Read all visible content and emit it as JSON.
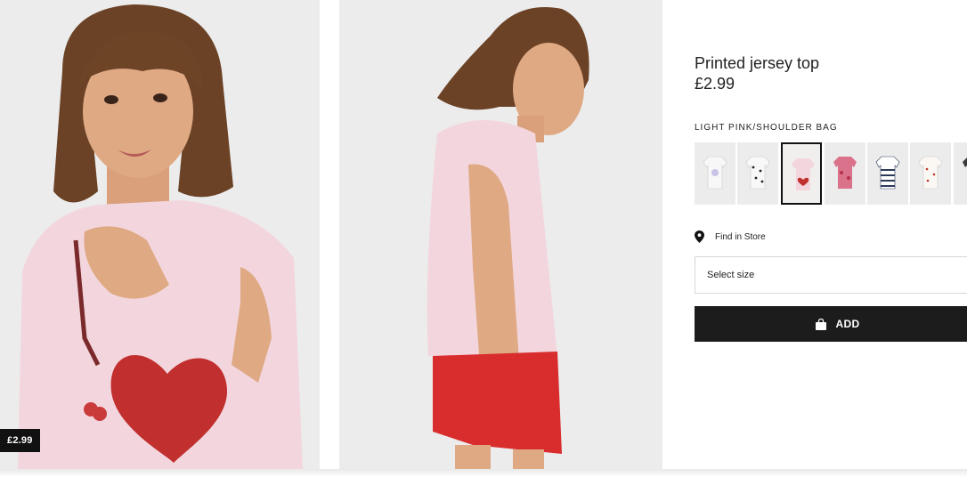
{
  "product": {
    "title": "Printed jersey top",
    "price": "£2.99",
    "price_badge": "£2.99",
    "color_label": "LIGHT PINK/SHOULDER BAG"
  },
  "swatches": [
    {
      "name": "white-print",
      "selected": false
    },
    {
      "name": "white-dots",
      "selected": false
    },
    {
      "name": "light-pink-shoulder-bag",
      "selected": true
    },
    {
      "name": "pink-floral",
      "selected": false
    },
    {
      "name": "navy-stripe",
      "selected": false
    },
    {
      "name": "white-cherry",
      "selected": false
    },
    {
      "name": "dark-print",
      "selected": false
    }
  ],
  "find_in_store": {
    "label": "Find in Store",
    "icon": "location-pin-icon"
  },
  "size_select": {
    "label": "Select size"
  },
  "add_button": {
    "label": "ADD",
    "icon": "bag-icon"
  },
  "colors": {
    "button_bg": "#1c1c1c",
    "shirt_pink": "#f3d6dd",
    "shorts_red": "#d92c2c"
  }
}
